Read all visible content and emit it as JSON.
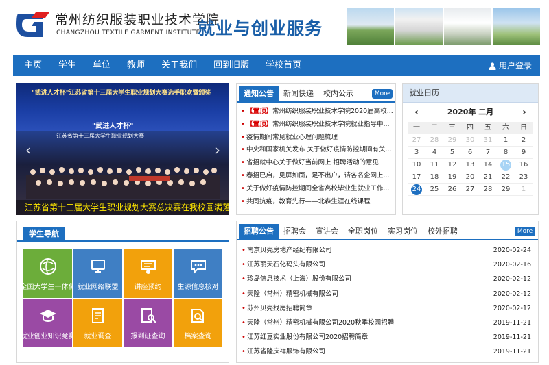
{
  "header": {
    "school_cn": "常州纺织服装职业技术学院",
    "school_en": "CHANGZHOU TEXTILE GARMENT INSTITUTE",
    "site_title": "就业与创业服务"
  },
  "nav": {
    "items": [
      "主页",
      "学生",
      "单位",
      "教师",
      "关于我们",
      "回到旧版",
      "学校首页"
    ],
    "login": "用户登录"
  },
  "slider": {
    "banner_text": "\"武进人才杯\"江苏省第十三届大学生职业规划大赛选手职欢暨颁奖",
    "banner_sub": "江苏省第十三届大学生职业规划大赛",
    "sign_text": "\"武进人才杯\"",
    "caption": "江苏省第十三届大学生职业规划大赛总决赛在我校圆满落"
  },
  "notice": {
    "tabs": [
      "通知公告",
      "新闻快递",
      "校内公示"
    ],
    "more": "More",
    "items": [
      {
        "tag": "【置顶】",
        "text": "常州纺织服装职业技术学院2020届高校..."
      },
      {
        "tag": "【置顶】",
        "text": "常州纺织服装职业技术学院就业指导中..."
      },
      {
        "tag": "",
        "text": "疫情期间常见就业心理问题梳理"
      },
      {
        "tag": "",
        "text": "中央和国家机关发布 关于做好疫情防控期间有关..."
      },
      {
        "tag": "",
        "text": "省招就中心关于做好当前网上 招聘活动的意见"
      },
      {
        "tag": "",
        "text": "春招已启，见屏如面，足不出户，请各名企网上..."
      },
      {
        "tag": "",
        "text": "关于做好疫情防控期间全省高校毕业生就业工作..."
      },
      {
        "tag": "",
        "text": "共同抗疫，教育先行——北森生涯在线课程"
      }
    ]
  },
  "calendar": {
    "title": "就业日历",
    "month_label": "2020年 二月",
    "prev": "‹",
    "next": "›",
    "weekdays": [
      "一",
      "二",
      "三",
      "四",
      "五",
      "六",
      "日"
    ],
    "days": [
      "27",
      "28",
      "29",
      "30",
      "31",
      "1",
      "2",
      "3",
      "4",
      "5",
      "6",
      "7",
      "8",
      "9",
      "10",
      "11",
      "12",
      "13",
      "14",
      "15",
      "16",
      "17",
      "18",
      "19",
      "20",
      "21",
      "22",
      "23",
      "24",
      "25",
      "26",
      "27",
      "28",
      "29",
      "1"
    ],
    "dim_indices": [
      0,
      1,
      2,
      3,
      4,
      34
    ],
    "today_index": 28,
    "highlight_index": 19
  },
  "guide": {
    "title": "学生导航",
    "tiles": [
      {
        "label": "全国大学生一体化",
        "color": "#6cad3a",
        "icon": "globe-icon"
      },
      {
        "label": "就业网络联盟",
        "color": "#3f7fc4",
        "icon": "network-icon"
      },
      {
        "label": "讲座预约",
        "color": "#f2a10c",
        "icon": "lecture-icon"
      },
      {
        "label": "生源信息核对",
        "color": "#3f7fc4",
        "icon": "chat-icon"
      },
      {
        "label": "就业创业知识竞赛",
        "color": "#9a4aa4",
        "icon": "graduation-cap-icon"
      },
      {
        "label": "就业调查",
        "color": "#f2a10c",
        "icon": "survey-icon"
      },
      {
        "label": "报到证查询",
        "color": "#9a4aa4",
        "icon": "document-search-icon"
      },
      {
        "label": "档案查询",
        "color": "#f2a10c",
        "icon": "archive-search-icon"
      }
    ]
  },
  "jobs": {
    "tabs": [
      "招聘公告",
      "招聘会",
      "宣讲会",
      "全职岗位",
      "实习岗位",
      "校外招聘"
    ],
    "more": "More",
    "items": [
      {
        "text": "南京贝壳房地产经纪有限公司",
        "date": "2020-02-24"
      },
      {
        "text": "江苏丽天石化码头有限公司",
        "date": "2020-02-16"
      },
      {
        "text": "珍岛信息技术（上海）股份有限公司",
        "date": "2020-02-12"
      },
      {
        "text": "天隆（常州）精密机械有限公司",
        "date": "2020-02-12"
      },
      {
        "text": "苏州贝壳找房招聘简章",
        "date": "2020-02-12"
      },
      {
        "text": "天隆（常州）精密机械有限公司2020秋季校园招聘",
        "date": "2019-11-21"
      },
      {
        "text": "江苏红豆实业股份有限公司2020招聘简章",
        "date": "2019-11-21"
      },
      {
        "text": "江苏省隆庆祥服饰有限公司",
        "date": "2019-11-21"
      }
    ]
  },
  "colors": {
    "primary": "#1d6fc0",
    "top_tag": "#d80000",
    "caption": "#ffe800"
  }
}
